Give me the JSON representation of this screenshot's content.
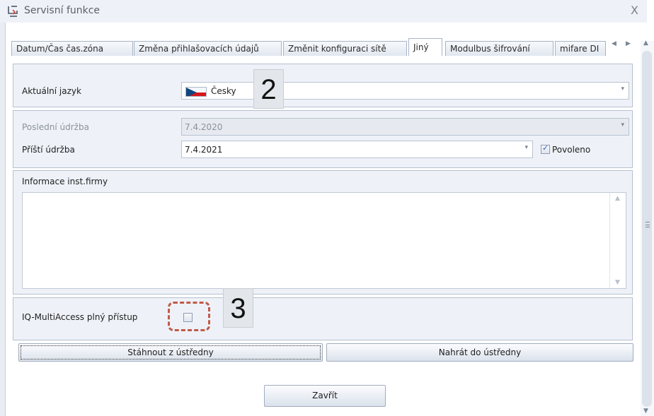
{
  "window": {
    "title": "Servisní funkce",
    "icon": "service-icon",
    "close_icon": "close-icon"
  },
  "tabs": [
    {
      "label": "Datum/Čas čas.zóna",
      "active": false
    },
    {
      "label": "Změna přihlašovacích údajů",
      "active": false
    },
    {
      "label": "Změnit konfiguraci sítě",
      "active": false
    },
    {
      "label": "Jiný",
      "active": true
    },
    {
      "label": "Modulbus šifrování",
      "active": false
    },
    {
      "label": "mifare DI",
      "active": false
    }
  ],
  "tab_nav": {
    "prev_icon": "tab-left-arrow-icon",
    "next_icon": "tab-right-arrow-icon",
    "prev": "◀",
    "next": "▶"
  },
  "language": {
    "label": "Aktuální jazyk",
    "value": "Česky",
    "flag_icon": "czech-flag-icon",
    "callout": "2"
  },
  "maintenance": {
    "last_label": "Poslední údržba",
    "last_value": "7.4.2020",
    "next_label": "Příští údržba",
    "next_value": "7.4.2021",
    "enabled_label": "Povoleno",
    "enabled_checked": true
  },
  "installer_info": {
    "label": "Informace inst.firmy",
    "value": ""
  },
  "multiaccess": {
    "label": "IQ-MultiAccess plný přístup",
    "checked": false,
    "callout": "3"
  },
  "buttons": {
    "download": "Stáhnout z ústředny",
    "upload": "Nahrát do ústředny",
    "close": "Zavřít"
  },
  "colors": {
    "accent": "#c15a49",
    "panel": "#eef2f8",
    "border": "#a8b3c4"
  }
}
